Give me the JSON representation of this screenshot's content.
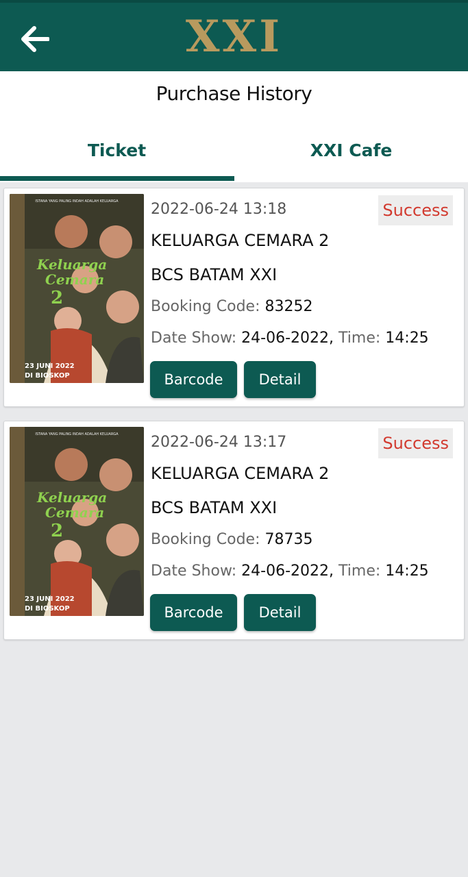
{
  "header": {
    "logo": "XXI",
    "back_icon": "arrow-left-icon"
  },
  "page_title": "Purchase History",
  "tabs": [
    {
      "label": "Ticket",
      "active": true
    },
    {
      "label": "XXI Cafe",
      "active": false
    }
  ],
  "colors": {
    "primary": "#0d5a52",
    "logo_gold": "#b89a5e",
    "success_red": "#d23a2f",
    "background": "#e8e9eb"
  },
  "tickets": [
    {
      "datetime": "2022-06-24 13:18",
      "status": "Success",
      "movie": "KELUARGA CEMARA 2",
      "cinema": "BCS BATAM XXI",
      "booking_label": "Booking Code:",
      "booking_code": "83252",
      "date_label": "Date Show:",
      "date": "24-06-2022,",
      "time_label": "Time:",
      "time": "14:25",
      "barcode_label": "Barcode",
      "detail_label": "Detail",
      "poster": {
        "tagline": "ISTANA YANG PALING INDAH ADALAH KELUARGA",
        "title_line1": "Keluarga",
        "title_line2": "Cemara",
        "title_num": "2",
        "release": "23 JUNI 2022",
        "release_sub": "DI BIOSKOP"
      }
    },
    {
      "datetime": "2022-06-24 13:17",
      "status": "Success",
      "movie": "KELUARGA CEMARA 2",
      "cinema": "BCS BATAM XXI",
      "booking_label": "Booking Code:",
      "booking_code": "78735",
      "date_label": "Date Show:",
      "date": "24-06-2022,",
      "time_label": "Time:",
      "time": "14:25",
      "barcode_label": "Barcode",
      "detail_label": "Detail",
      "poster": {
        "tagline": "ISTANA YANG PALING INDAH ADALAH KELUARGA",
        "title_line1": "Keluarga",
        "title_line2": "Cemara",
        "title_num": "2",
        "release": "23 JUNI 2022",
        "release_sub": "DI BIOSKOP"
      }
    }
  ]
}
